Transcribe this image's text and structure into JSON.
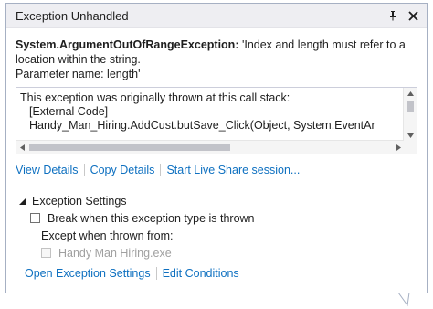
{
  "titlebar": {
    "title": "Exception Unhandled"
  },
  "message": {
    "exception_type": "System.ArgumentOutOfRangeException:",
    "text": " 'Index and length must refer to a location within the string.",
    "parameter": "Parameter name: length'"
  },
  "callstack": {
    "intro": "This exception was originally thrown at this call stack:",
    "frames": [
      "[External Code]",
      "Handy_Man_Hiring.AddCust.butSave_Click(Object, System.EventAr"
    ]
  },
  "actions": {
    "view_details": "View Details",
    "copy_details": "Copy Details",
    "live_share": "Start Live Share session..."
  },
  "settings": {
    "header": "Exception Settings",
    "break_label": "Break when this exception type is thrown",
    "except_label": "Except when thrown from:",
    "module_label": "Handy Man Hiring.exe",
    "open_settings": "Open Exception Settings",
    "edit_conditions": "Edit Conditions"
  },
  "icons": {
    "pin": "pin-icon",
    "close": "close-icon"
  },
  "colors": {
    "link": "#0e70c0",
    "titlebar_bg": "#eeeef2",
    "border": "#a6b0c3"
  }
}
